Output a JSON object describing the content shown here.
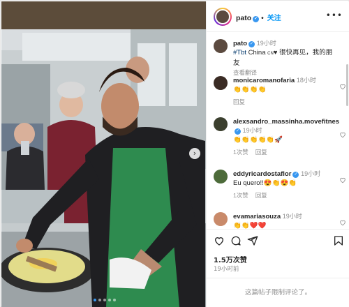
{
  "post": {
    "username": "pato",
    "follow_label": "关注",
    "more_label": "•••"
  },
  "caption": {
    "username": "pato",
    "time": "19小时",
    "hashtag": "#Tbt",
    "text": " China ",
    "flag": "CN",
    "text_after": "♥ 很快再见，我的朋友",
    "translate_label": "查看翻译"
  },
  "comments": [
    {
      "username": "monicaromanofaria",
      "time": "18小时",
      "text": "👏👏👏👏",
      "reply_label": "回复",
      "likes_label": ""
    },
    {
      "username": "alexsandro_massinha.movefitnes",
      "time": "19小时",
      "text": "👏👏👏👏👏🚀",
      "likes_label": "1次赞",
      "reply_label": "回复"
    },
    {
      "username": "eddyricardostaflor",
      "time": "19小时",
      "text": "Eu quero!!😍👏😍👏",
      "likes_label": "1次赞",
      "reply_label": "回复"
    },
    {
      "username": "evamariasouza",
      "time": "19小时",
      "text": "👏👏❤️❤️",
      "reply_label": "",
      "likes_label": ""
    }
  ],
  "actions": {
    "likes": "1.5万次赞",
    "posted": "19小时前"
  },
  "footer": {
    "disabled_text": "这篇帖子限制评论了。"
  },
  "colors": {
    "link_blue": "#0095f6",
    "verified": "#3897f0",
    "apron_green": "#2e8b4f"
  }
}
